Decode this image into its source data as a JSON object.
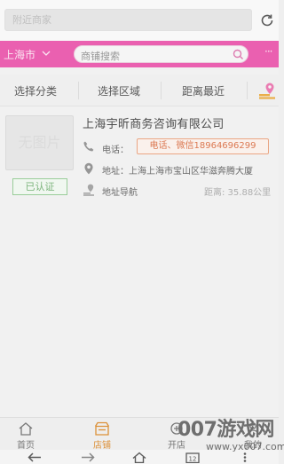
{
  "top": {
    "search_placeholder": "附近商家",
    "refresh_icon": "refresh-icon"
  },
  "header": {
    "city": "上海市",
    "shop_search_placeholder": "商铺搜索",
    "more_label": "···",
    "accent_color": "#e84aa6"
  },
  "filters": {
    "category": "选择分类",
    "region": "选择区域",
    "distance": "距离最近",
    "map_icon": "map-pin-icon"
  },
  "store": {
    "thumb_text": "无图片",
    "verified": "已认证",
    "name": "上海宇昕商务咨询有限公司",
    "phone_label": "电话：",
    "phone_button": "电话、微信18964696299",
    "address": "地址：上海上海市宝山区华滋奔腾大厦",
    "nav_label": "地址导航",
    "distance": "距离: 35.88公里"
  },
  "bottom_nav": [
    {
      "label": "首页",
      "icon": "home-icon"
    },
    {
      "label": "店铺",
      "icon": "shop-icon"
    },
    {
      "label": "开店",
      "icon": "open-shop-icon"
    },
    {
      "label": "我的",
      "icon": "user-icon"
    }
  ],
  "watermark": {
    "brand": "007游戏网",
    "url": "www.yx007.com"
  }
}
